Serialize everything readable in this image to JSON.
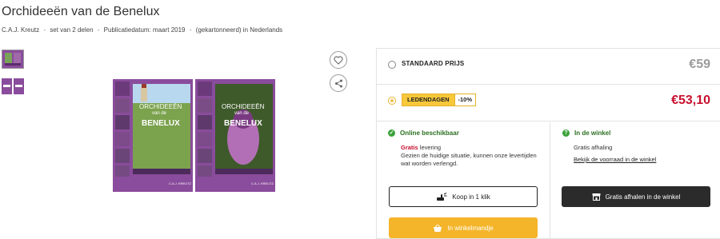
{
  "product": {
    "title": "Orchideeën van de Benelux",
    "author": "C.A.J. Kreutz",
    "set": "set van 2 delen",
    "publication": "Publicatiedatum: maart 2019",
    "binding": "(gekartonneerd) in Nederlands",
    "separator": "-",
    "cover_title_top": "ORCHIDEEËN",
    "cover_title_mid": "van de",
    "cover_title_main": "BENELUX",
    "cover_author": "C.A.J. KREUTZ"
  },
  "pricing": {
    "standard_label": "STANDAARD PRIJS",
    "standard_price": "€59",
    "member_badge": "LEDENDAGEN",
    "member_discount": "-10%",
    "member_price": "€53,10"
  },
  "availability": {
    "online_title": "Online beschikbaar",
    "online_free": "Gratis",
    "online_delivery": "levering",
    "online_note": "Gezien de huidige situatie, kunnen onze levertijden wat worden verlengd.",
    "store_title": "In de winkel",
    "store_pickup": "Gratis afhaling",
    "store_link": "Bekijk de voorraad in de winkel"
  },
  "buttons": {
    "buy_one_click": "Koop in 1 klik",
    "pickup_store": "Gratis afhalen in de winkel",
    "add_to_cart": "In winkelmandje"
  },
  "icons": {
    "favorite": "heart-icon",
    "share": "share-icon",
    "one_click": "hand-click-icon",
    "store": "store-icon",
    "cart": "basket-icon",
    "online_check": "check-icon",
    "store_info": "question-icon"
  },
  "colors": {
    "price_red": "#c8102e",
    "badge_yellow": "#f8c83a",
    "cart_button": "#f4b52b",
    "available_green": "#3aa23a",
    "dark_button": "#2b2b2b",
    "cover_purple": "#8a4c9c"
  }
}
